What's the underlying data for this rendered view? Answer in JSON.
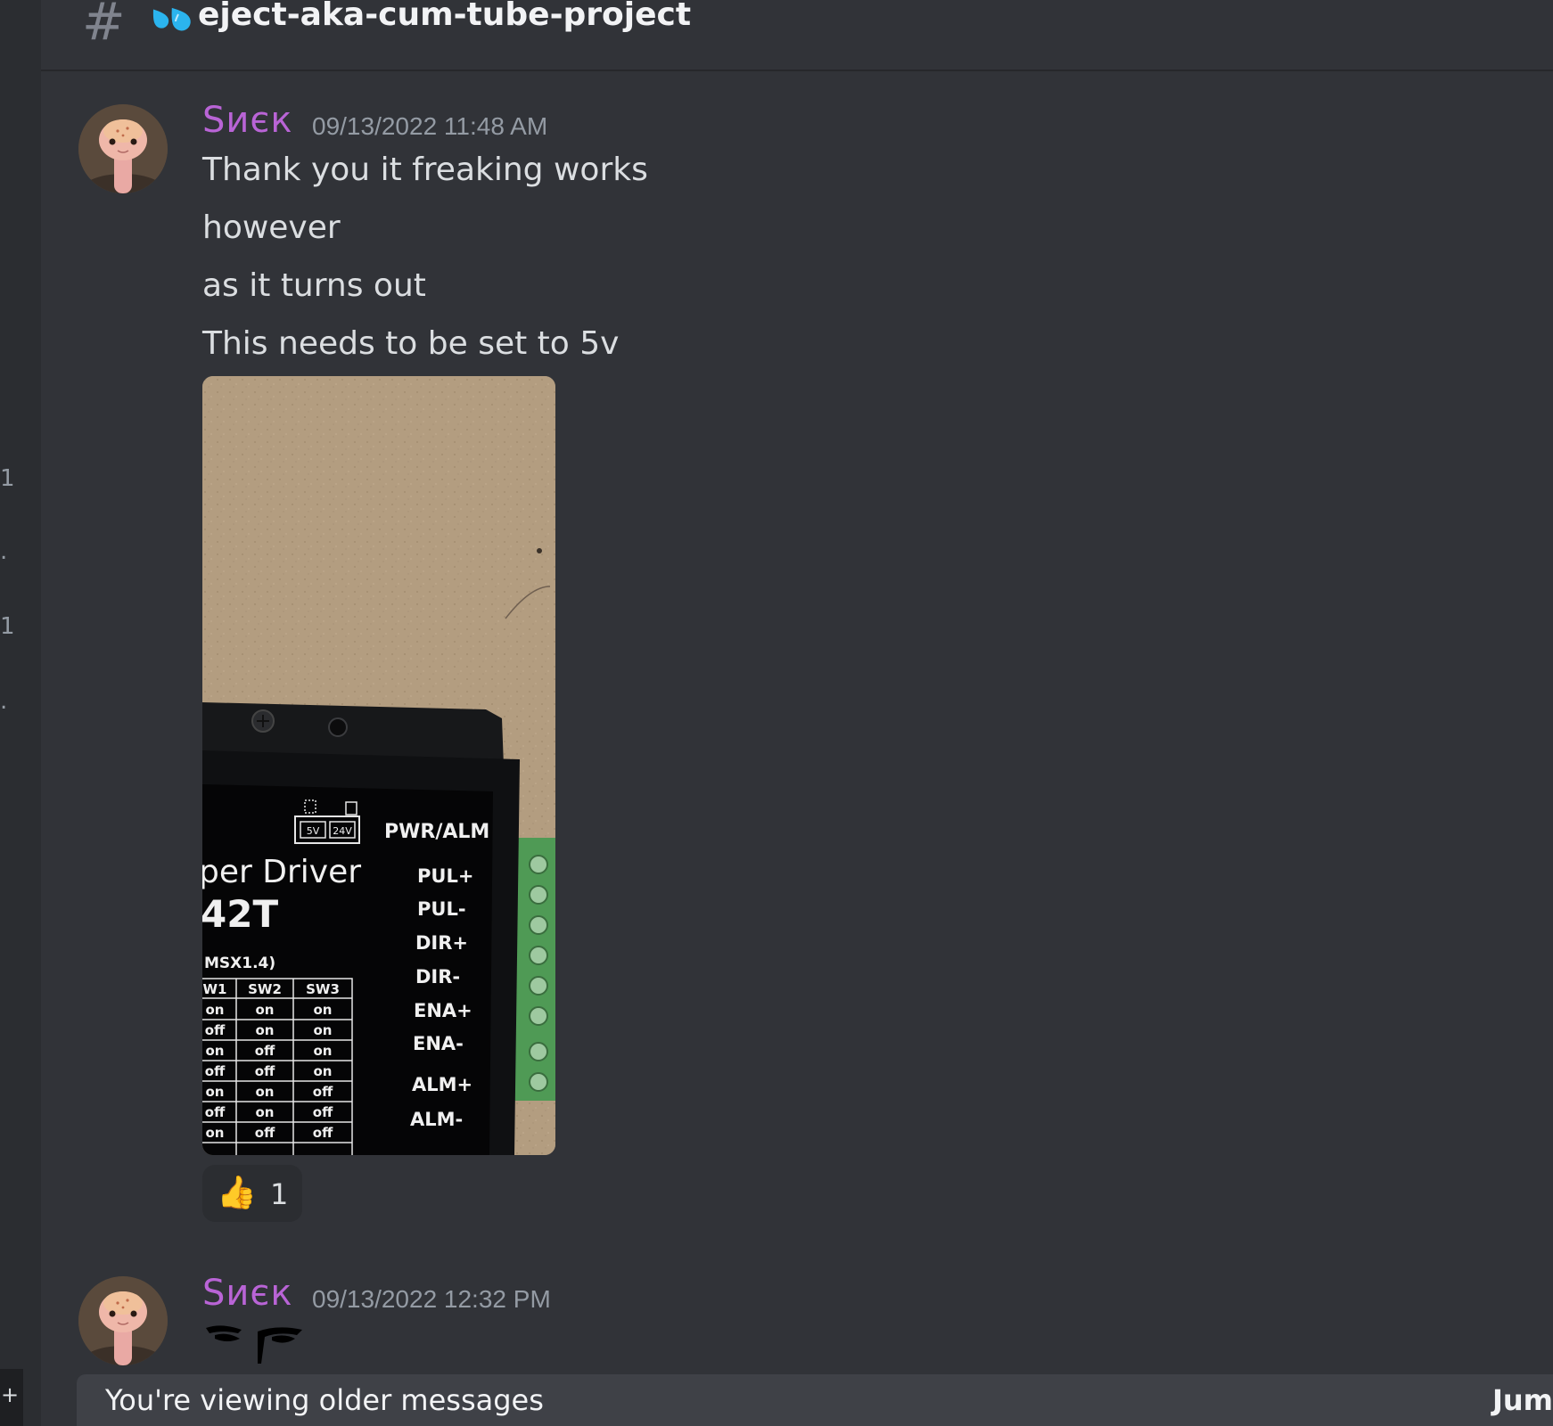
{
  "channel": {
    "icon": "hash-icon",
    "emoji_icon": "sweat-droplets-icon",
    "name": "eject-aka-cum-tube-project"
  },
  "left_strip": {
    "marks": [
      "1",
      ".",
      "1",
      ".",
      "+"
    ]
  },
  "messages": [
    {
      "username": "Ѕиєк",
      "timestamp": "09/13/2022 11:48 AM",
      "lines": [
        "Thank you it freaking works",
        "however",
        "as it turns out",
        "This needs to be set to 5v"
      ],
      "attachment": {
        "labels": {
          "switch_5v": "5V",
          "switch_24v": "24V",
          "pwr_alm": "PWR/ALM",
          "title": "per Driver",
          "model": "42T",
          "table_caption": "MSX1.4)",
          "pins": [
            "PUL+",
            "PUL-",
            "DIR+",
            "DIR-",
            "ENA+",
            "ENA-",
            "ALM+",
            "ALM-"
          ],
          "table_headers": [
            "W1",
            "SW2",
            "SW3"
          ],
          "table_rows": [
            [
              "on",
              "on",
              "on"
            ],
            [
              "off",
              "on",
              "on"
            ],
            [
              "on",
              "off",
              "on"
            ],
            [
              "off",
              "off",
              "on"
            ],
            [
              "on",
              "on",
              "off"
            ],
            [
              "off",
              "on",
              "off"
            ],
            [
              "on",
              "off",
              "off"
            ]
          ]
        }
      },
      "reaction": {
        "emoji": "👍",
        "count": "1"
      }
    },
    {
      "username": "Ѕиєк",
      "timestamp": "09/13/2022 12:32 PM"
    }
  ],
  "older_bar": {
    "text": "You're viewing older messages",
    "jump": "Jum"
  },
  "colors": {
    "background": "#313338",
    "sidebar": "#2b2d31",
    "username": "#b964d6",
    "text": "#dbdee1",
    "timestamp": "#949ba4",
    "banner": "#3f4147"
  }
}
